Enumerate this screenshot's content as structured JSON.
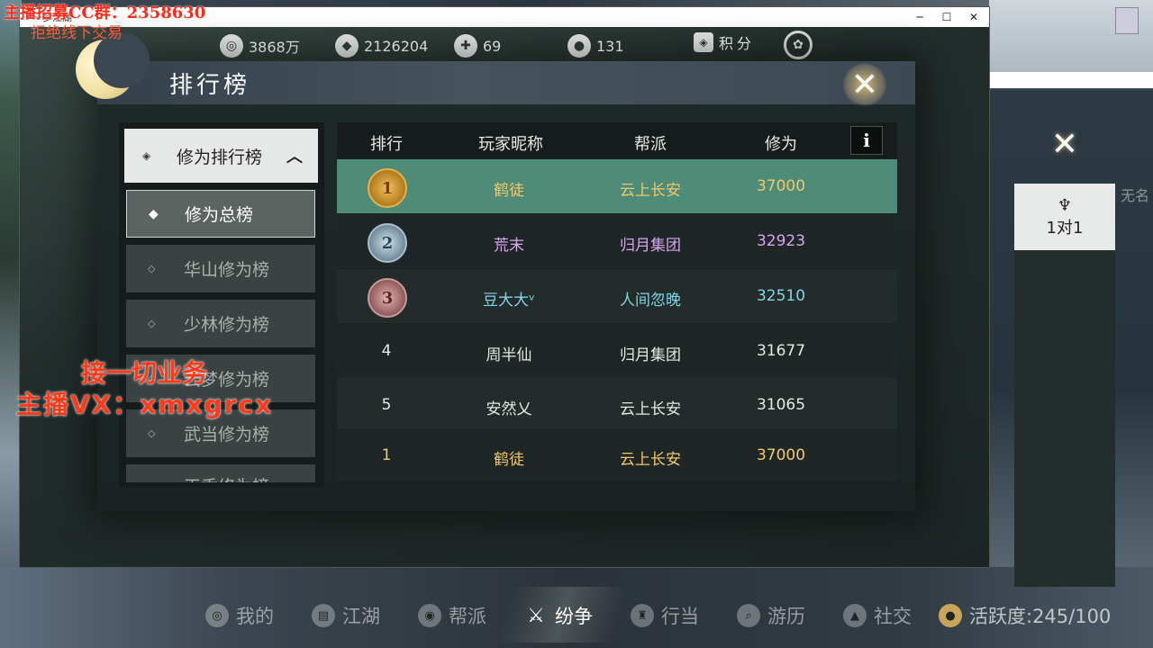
{
  "overlay": {
    "top_line1": "主播招募CC群：2358630",
    "top_line2": "拒绝线下交易",
    "mid_line1": "接一切业务",
    "mid_line2": "主播VX：xmxgrcx"
  },
  "window": {
    "title": "一梦江湖",
    "minimize": "─",
    "maximize": "☐",
    "close": "✕"
  },
  "resources": [
    {
      "icon": "coin-icon",
      "glyph": "◎",
      "value": "3868万"
    },
    {
      "icon": "ingot-icon",
      "glyph": "◆",
      "value": "2126204"
    },
    {
      "icon": "ticket-icon",
      "glyph": "✚",
      "value": "69"
    },
    {
      "icon": "gold-ingot-icon",
      "glyph": "●",
      "value": "131"
    }
  ],
  "jifen": {
    "label": "积分",
    "glyph": "◈"
  },
  "panel": {
    "title": "排行榜",
    "close": "✕"
  },
  "menu": {
    "header": {
      "label": "修为排行榜",
      "dots": "◈",
      "caret": "︿"
    },
    "items": [
      {
        "label": "修为总榜",
        "bullet": "◆",
        "active": true
      },
      {
        "label": "华山修为榜",
        "bullet": "◇"
      },
      {
        "label": "少林修为榜",
        "bullet": "◇"
      },
      {
        "label": "云梦修为榜",
        "bullet": "◇"
      },
      {
        "label": "武当修为榜",
        "bullet": "◇"
      },
      {
        "label": "天香修为榜",
        "bullet": "◇"
      }
    ]
  },
  "table": {
    "headers": [
      "排行",
      "玩家昵称",
      "帮派",
      "修为"
    ],
    "info": "i",
    "rows": [
      {
        "rank": "1",
        "name": "鹤徒",
        "guild": "云上长安",
        "score": "37000",
        "medal": "gold",
        "color": "#f2c86b"
      },
      {
        "rank": "2",
        "name": "荒末",
        "guild": "归月集团",
        "score": "32923",
        "medal": "silver",
        "color": "#d9a4f0"
      },
      {
        "rank": "3",
        "name": "豆大大ᵛ",
        "guild": "人间忽晚",
        "score": "32510",
        "medal": "bronze",
        "color": "#7fd4e6"
      },
      {
        "rank": "4",
        "name": "周半仙",
        "guild": "归月集团",
        "score": "31677",
        "medal": "",
        "color": "#e6e8e7"
      },
      {
        "rank": "5",
        "name": "安然乂",
        "guild": "云上长安",
        "score": "31065",
        "medal": "",
        "color": "#e6e8e7"
      },
      {
        "rank": "1",
        "name": "鹤徒",
        "guild": "云上长安",
        "score": "37000",
        "medal": "",
        "color": "#f2c86b"
      }
    ]
  },
  "right_panel": {
    "tab_icon": "♆",
    "tab_label": "1对1",
    "close": "✕",
    "side_text": "无名"
  },
  "bottom_nav": [
    {
      "label": "我的",
      "glyph": "◎"
    },
    {
      "label": "江湖",
      "glyph": "▤"
    },
    {
      "label": "帮派",
      "glyph": "◉"
    },
    {
      "label": "纷争",
      "glyph": "⚔",
      "active": true
    },
    {
      "label": "行当",
      "glyph": "♜"
    },
    {
      "label": "游历",
      "glyph": "⌕"
    },
    {
      "label": "社交",
      "glyph": "▲"
    },
    {
      "label": "活跃度:245/100",
      "glyph": "●"
    }
  ],
  "colors": {
    "highlight_row": "#4e8c77",
    "gold": "#f2c86b",
    "purple": "#d9a4f0",
    "cyan": "#7fd4e6",
    "overlay_red": "#ff2a18"
  }
}
